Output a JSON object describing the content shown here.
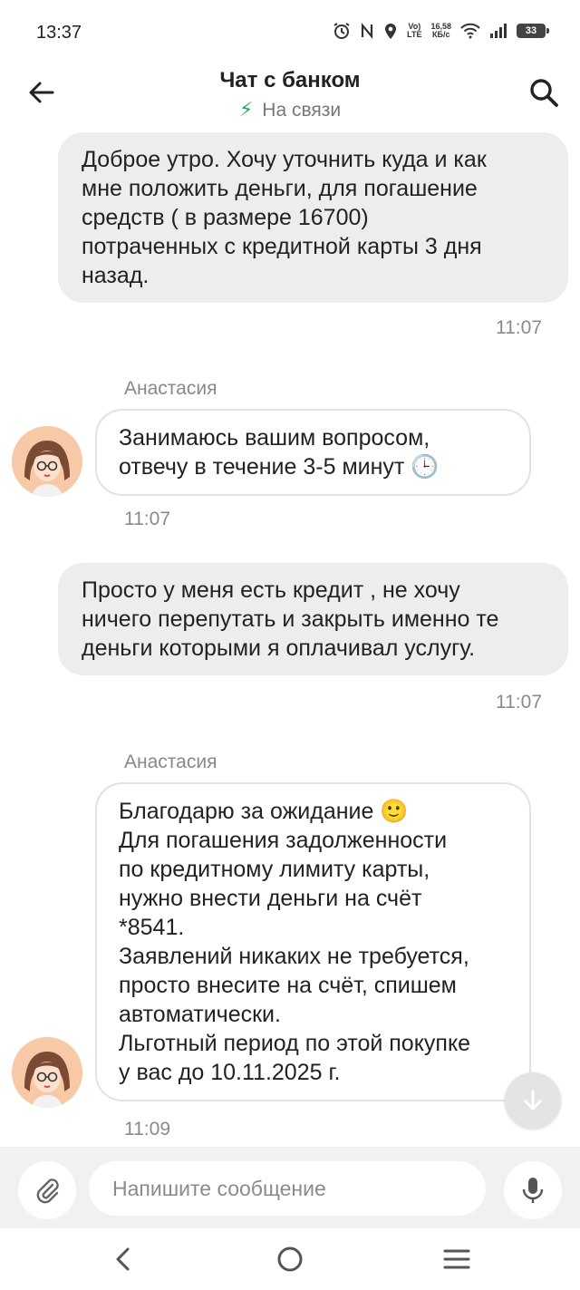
{
  "status_bar": {
    "time": "13:37",
    "speed_value": "16,58",
    "speed_unit": "КБ/с",
    "network_top": "Vo)",
    "network_bottom": "LTE",
    "battery": "33",
    "icons": [
      "alarm-icon",
      "nfc-icon",
      "location-icon",
      "volte-icon",
      "wifi-icon",
      "signal-icon",
      "battery-icon"
    ]
  },
  "header": {
    "title": "Чат с банком",
    "status": "На связи",
    "status_color": "#21b05a"
  },
  "messages": [
    {
      "direction": "outgoing",
      "lines": [
        "Доброе утро. Хочу уточнить куда и как",
        "мне положить деньги, для погашение",
        "средств ( в размере 16700)",
        "потраченных с кредитной карты 3 дня",
        "назад."
      ],
      "time": "11:07"
    },
    {
      "direction": "incoming",
      "sender": "Анастасия",
      "lines": [
        "Занимаюсь вашим вопросом,",
        "отвечу в течение 3-5 минут 🕒"
      ],
      "time": "11:07"
    },
    {
      "direction": "outgoing",
      "lines": [
        "Просто у меня есть кредит , не хочу",
        "ничего перепутать и закрыть именно те",
        "деньги которыми я оплачивал услугу."
      ],
      "time": "11:07"
    },
    {
      "direction": "incoming",
      "sender": "Анастасия",
      "lines": [
        "Благодарю за ожидание 🙂",
        "Для погашения задолженности",
        "по кредитному лимиту карты,",
        "нужно внести деньги на счёт",
        "*8541.",
        "Заявлений никаких не требуется,",
        "просто внесите на счёт, спишем",
        "автоматически.",
        "Льготный период по этой покупке",
        "у вас до 10.11.2025 г."
      ],
      "time": "11:09"
    }
  ],
  "composer": {
    "placeholder": "Напишите сообщение",
    "value": ""
  },
  "colors": {
    "outgoing_bubble": "#ededf0",
    "incoming_border": "#e2e2e6",
    "accent_green": "#21b05a"
  }
}
